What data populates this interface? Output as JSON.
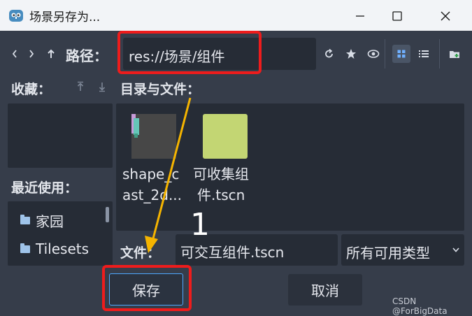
{
  "window": {
    "title": "场景另存为..."
  },
  "toolbar": {
    "path_label": "路径：",
    "path_value": "res://场景/组件"
  },
  "favorites": {
    "header": "收藏："
  },
  "recent": {
    "header": "最近使用：",
    "items": [
      {
        "label": "家园"
      },
      {
        "label": "Tilesets"
      }
    ]
  },
  "files": {
    "header": "目录与文件：",
    "items": [
      {
        "name_line1": "shape_c",
        "name_line2": "ast_2d..."
      },
      {
        "name_line1": "可收集组",
        "name_line2": "件.tscn"
      }
    ]
  },
  "footer": {
    "file_label": "文件：",
    "file_value": "可交互组件.tscn",
    "filter_value": "所有可用类型",
    "save_label": "保存",
    "cancel_label": "取消"
  },
  "annotation": {
    "step_number": "1",
    "highlight_color": "#ee1c1c",
    "arrow_color": "#f5b400"
  },
  "watermark": "CSDN @ForBigData",
  "colors": {
    "background": "#363d4a",
    "panel": "#262c36",
    "titlebar": "#f2f4f7",
    "accent": "#4fa8ff"
  }
}
